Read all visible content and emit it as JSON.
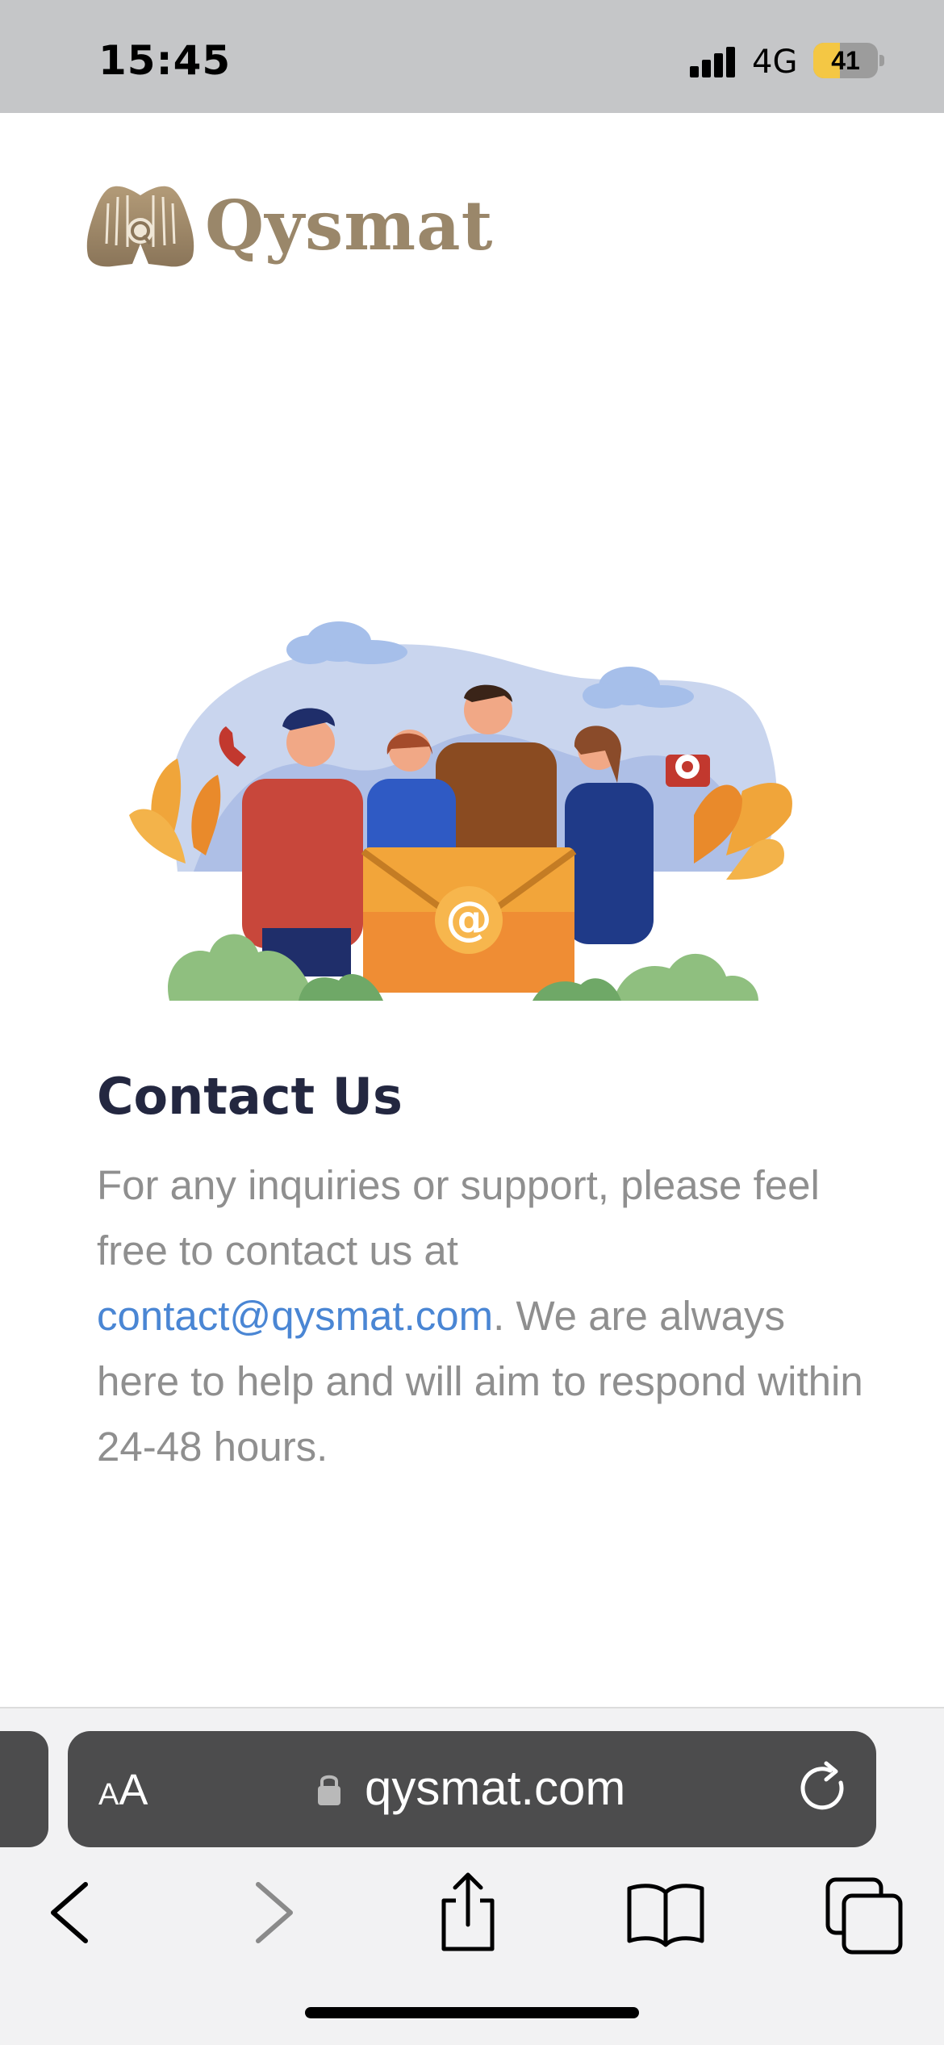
{
  "status_bar": {
    "time": "15:45",
    "network": "4G",
    "battery_level": "41"
  },
  "logo": {
    "text": "Qysmat",
    "icon": "praying-hands-icon"
  },
  "contact": {
    "title": "Contact Us",
    "text_before": "For any inquiries or support, please feel free to contact us at ",
    "email": "contact@qysmat.com",
    "text_after": ". We are always here to help and will aim to respond within 24-48 hours."
  },
  "browser": {
    "aa_small": "A",
    "aa_large": "A",
    "url": "qysmat.com",
    "buttons": [
      "back-icon",
      "forward-icon",
      "share-icon",
      "bookmarks-icon",
      "tabs-icon"
    ]
  },
  "colors": {
    "brand": "#9a876a",
    "title": "#232740",
    "link": "#4a86d4",
    "body_text": "#8f8f8f"
  }
}
